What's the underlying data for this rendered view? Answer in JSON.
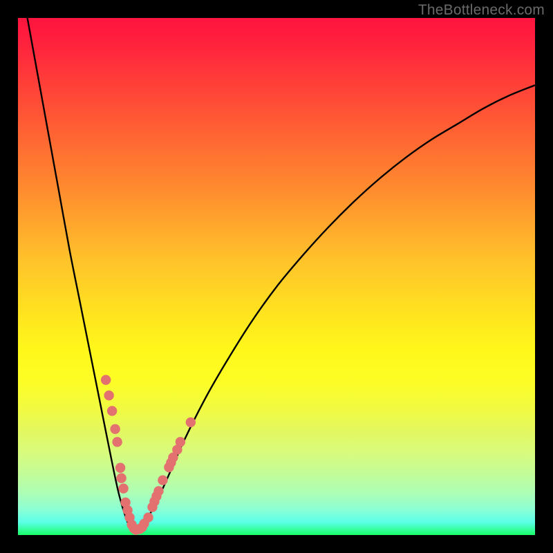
{
  "watermark": "TheBottleneck.com",
  "colors": {
    "frame": "#000000",
    "curve_stroke": "#000000",
    "dot_fill": "#e2716f",
    "gradient_top": "#ff153e",
    "gradient_bottom": "#19ff68"
  },
  "chart_data": {
    "type": "line",
    "title": "",
    "xlabel": "",
    "ylabel": "",
    "xlim": [
      0,
      100
    ],
    "ylim": [
      0,
      100
    ],
    "grid": false,
    "legend": false,
    "annotations": [
      "TheBottleneck.com"
    ],
    "series": [
      {
        "name": "bottleneck-curve",
        "x": [
          0,
          2,
          4,
          6,
          8,
          10,
          12,
          14,
          16,
          18,
          19.5,
          21,
          22,
          23,
          24,
          25,
          28,
          32,
          36,
          40,
          45,
          50,
          55,
          60,
          65,
          70,
          75,
          80,
          85,
          90,
          95,
          100
        ],
        "y": [
          110,
          99,
          88,
          77,
          66,
          55,
          45,
          35,
          25,
          15,
          8,
          3,
          1,
          0.5,
          1,
          3,
          9,
          18,
          26,
          33,
          41,
          48,
          54,
          59.5,
          64.5,
          69,
          73,
          76.5,
          79.5,
          82.5,
          85,
          87
        ]
      }
    ],
    "highlighted_points": [
      {
        "x": 17.0,
        "y": 30
      },
      {
        "x": 17.6,
        "y": 27
      },
      {
        "x": 18.2,
        "y": 24
      },
      {
        "x": 18.8,
        "y": 20.5
      },
      {
        "x": 19.2,
        "y": 18
      },
      {
        "x": 19.8,
        "y": 13
      },
      {
        "x": 20.0,
        "y": 11
      },
      {
        "x": 20.4,
        "y": 9
      },
      {
        "x": 20.8,
        "y": 6.3
      },
      {
        "x": 21.2,
        "y": 4.8
      },
      {
        "x": 21.6,
        "y": 3.4
      },
      {
        "x": 22.0,
        "y": 2.0
      },
      {
        "x": 22.4,
        "y": 1.3
      },
      {
        "x": 22.8,
        "y": 1.0
      },
      {
        "x": 23.2,
        "y": 1.1
      },
      {
        "x": 23.6,
        "y": 1.2
      },
      {
        "x": 24.0,
        "y": 1.5
      },
      {
        "x": 24.4,
        "y": 2.2
      },
      {
        "x": 25.2,
        "y": 3.4
      },
      {
        "x": 26.0,
        "y": 5.4
      },
      {
        "x": 26.4,
        "y": 6.5
      },
      {
        "x": 26.8,
        "y": 7.5
      },
      {
        "x": 27.2,
        "y": 8.5
      },
      {
        "x": 28.0,
        "y": 10.6
      },
      {
        "x": 29.2,
        "y": 13.1
      },
      {
        "x": 29.6,
        "y": 14.0
      },
      {
        "x": 30.0,
        "y": 15.0
      },
      {
        "x": 30.8,
        "y": 16.5
      },
      {
        "x": 31.4,
        "y": 18.0
      },
      {
        "x": 33.4,
        "y": 21.8
      }
    ]
  }
}
